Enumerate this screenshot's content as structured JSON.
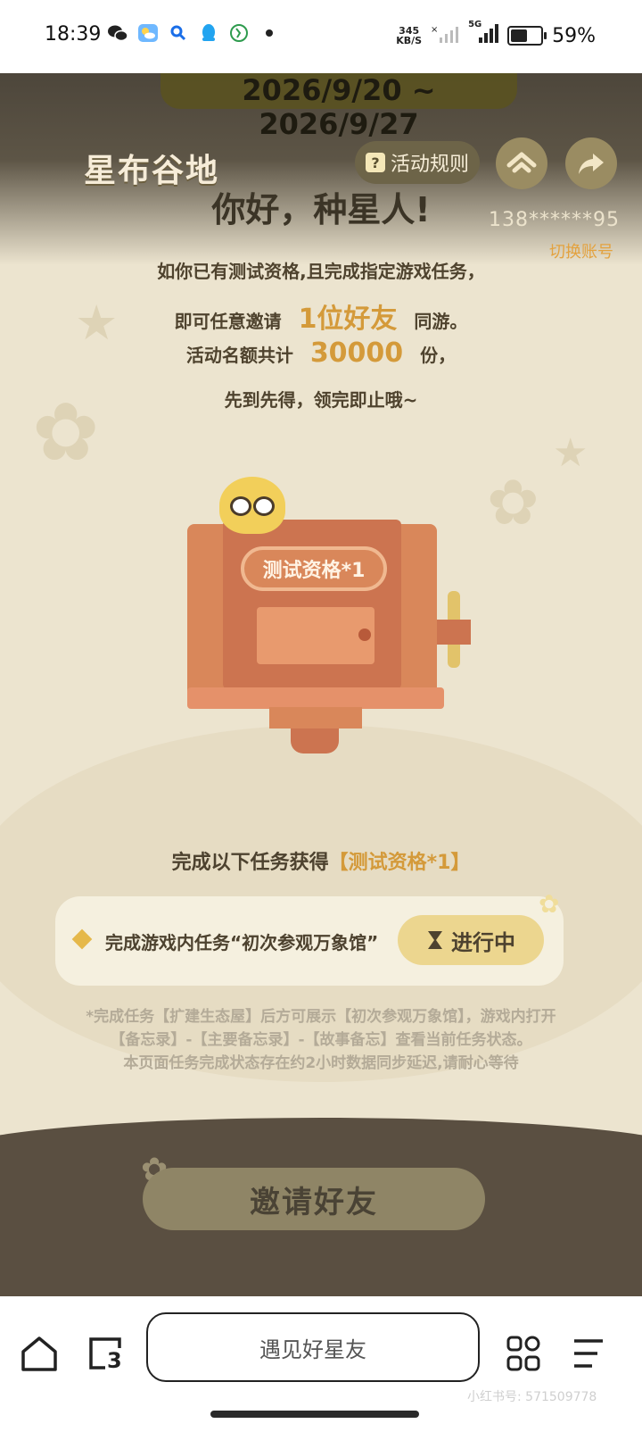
{
  "status_bar": {
    "time": "18:39",
    "net_speed_value": "345",
    "net_speed_unit": "KB/S",
    "network": "5G",
    "battery_percent": "59%",
    "battery_level": 0.59
  },
  "header": {
    "date_range": "2026/9/20 ~ 2026/9/27",
    "logo_text": "星布谷地",
    "rules_label": "活动规则",
    "greeting": "你好，种星人!",
    "account": "138******95",
    "switch_account": "切换账号"
  },
  "intro": {
    "line1": "如你已有测试资格,且完成指定游戏任务，",
    "line2_prefix": "即可任意邀请",
    "line2_highlight": "1位好友",
    "line2_suffix": "同游。",
    "line3_prefix": "活动名额共计",
    "line3_highlight": "30000",
    "line3_suffix": "份，",
    "line4": "先到先得，领完即止哦~"
  },
  "machine": {
    "label": "测试资格*1"
  },
  "tasks": {
    "title_prefix": "完成以下任务获得",
    "title_reward": "【测试资格*1】",
    "items": [
      {
        "text": "完成游戏内任务“初次参观万象馆”",
        "status": "进行中"
      }
    ],
    "note_line1": "*完成任务【扩建生态屋】后方可展示【初次参观万象馆】，游戏内打开",
    "note_line2": "【备忘录】-【主要备忘录】-【故事备忘】查看当前任务状态。",
    "note_line3": "本页面任务完成状态存在约2小时数据同步延迟,请耐心等待"
  },
  "invite_button": "邀请好友",
  "browser": {
    "page_title": "遇见好星友",
    "tab_count": "3",
    "watermark": "小红书号: 571509778"
  },
  "colors": {
    "accent": "#d49a3a",
    "machine": "#d9875a",
    "background": "#ece4cf"
  }
}
